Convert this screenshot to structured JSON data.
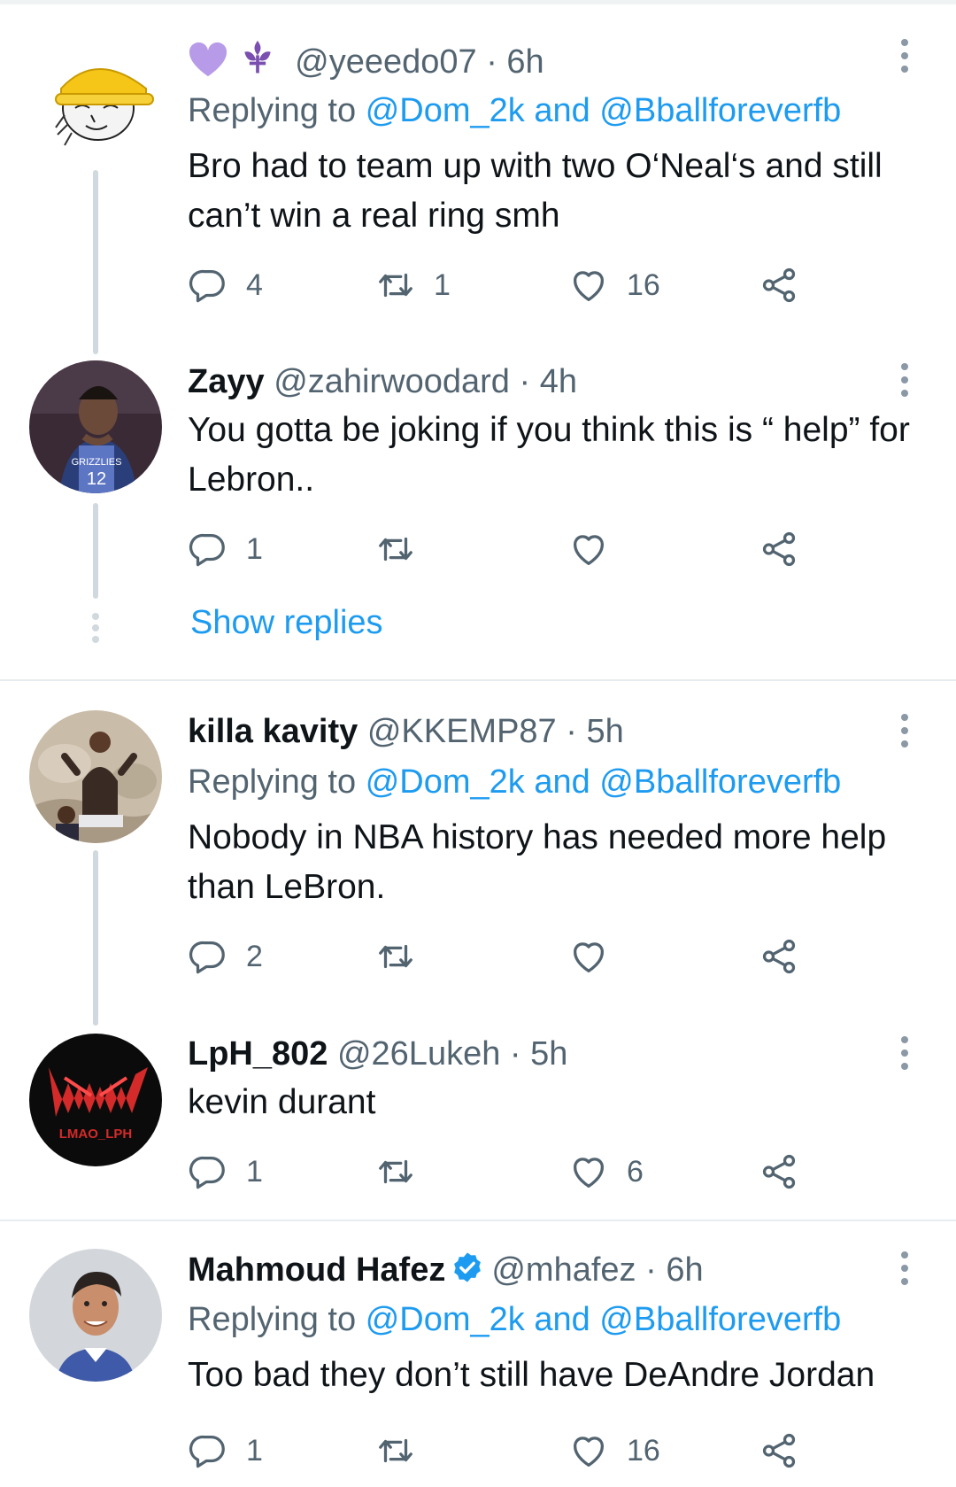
{
  "colors": {
    "link": "#1d9bf0",
    "muted": "#536471",
    "text": "#0f1419",
    "line": "#cfd9de",
    "heart_emoji": "#b79be8"
  },
  "tweets": [
    {
      "display_name": "",
      "name_emojis": [
        "purple-heart-icon",
        "fleur-de-lis-icon"
      ],
      "handle": "@yeeedo07",
      "time": "6h",
      "reply_prefix": "Replying to",
      "reply_users": "@Dom_2k and @Bballforeverfb",
      "text": "Bro had to team up with two O‘Neal‘s and still can’t win a real ring smh",
      "counts": {
        "reply": "4",
        "retweet": "1",
        "like": "16"
      }
    },
    {
      "display_name": "Zayy",
      "handle": "@zahirwoodard",
      "time": "4h",
      "text": "You gotta be joking if you think this is “ help” for Lebron..",
      "counts": {
        "reply": "1",
        "retweet": "",
        "like": ""
      },
      "avatar_text": "GRIZZLIES 12"
    },
    {
      "display_name": "killa kavity",
      "handle": "@KKEMP87",
      "time": "5h",
      "reply_prefix": "Replying to",
      "reply_users": "@Dom_2k and @Bballforeverfb",
      "text": "Nobody in NBA history has needed more help than LeBron.",
      "counts": {
        "reply": "2",
        "retweet": "",
        "like": ""
      }
    },
    {
      "display_name": "LpH_802",
      "handle": "@26Lukeh",
      "time": "5h",
      "text": "kevin durant",
      "counts": {
        "reply": "1",
        "retweet": "",
        "like": "6"
      },
      "avatar_text": "LMAO_LPH"
    },
    {
      "display_name": "Mahmoud Hafez",
      "verified": true,
      "handle": "@mhafez",
      "time": "6h",
      "reply_prefix": "Replying to",
      "reply_users": "@Dom_2k and @Bballforeverfb",
      "text": "Too bad they don’t still have DeAndre Jordan",
      "counts": {
        "reply": "1",
        "retweet": "",
        "like": "16"
      }
    }
  ],
  "show_replies_label": "Show replies",
  "separator": "·"
}
